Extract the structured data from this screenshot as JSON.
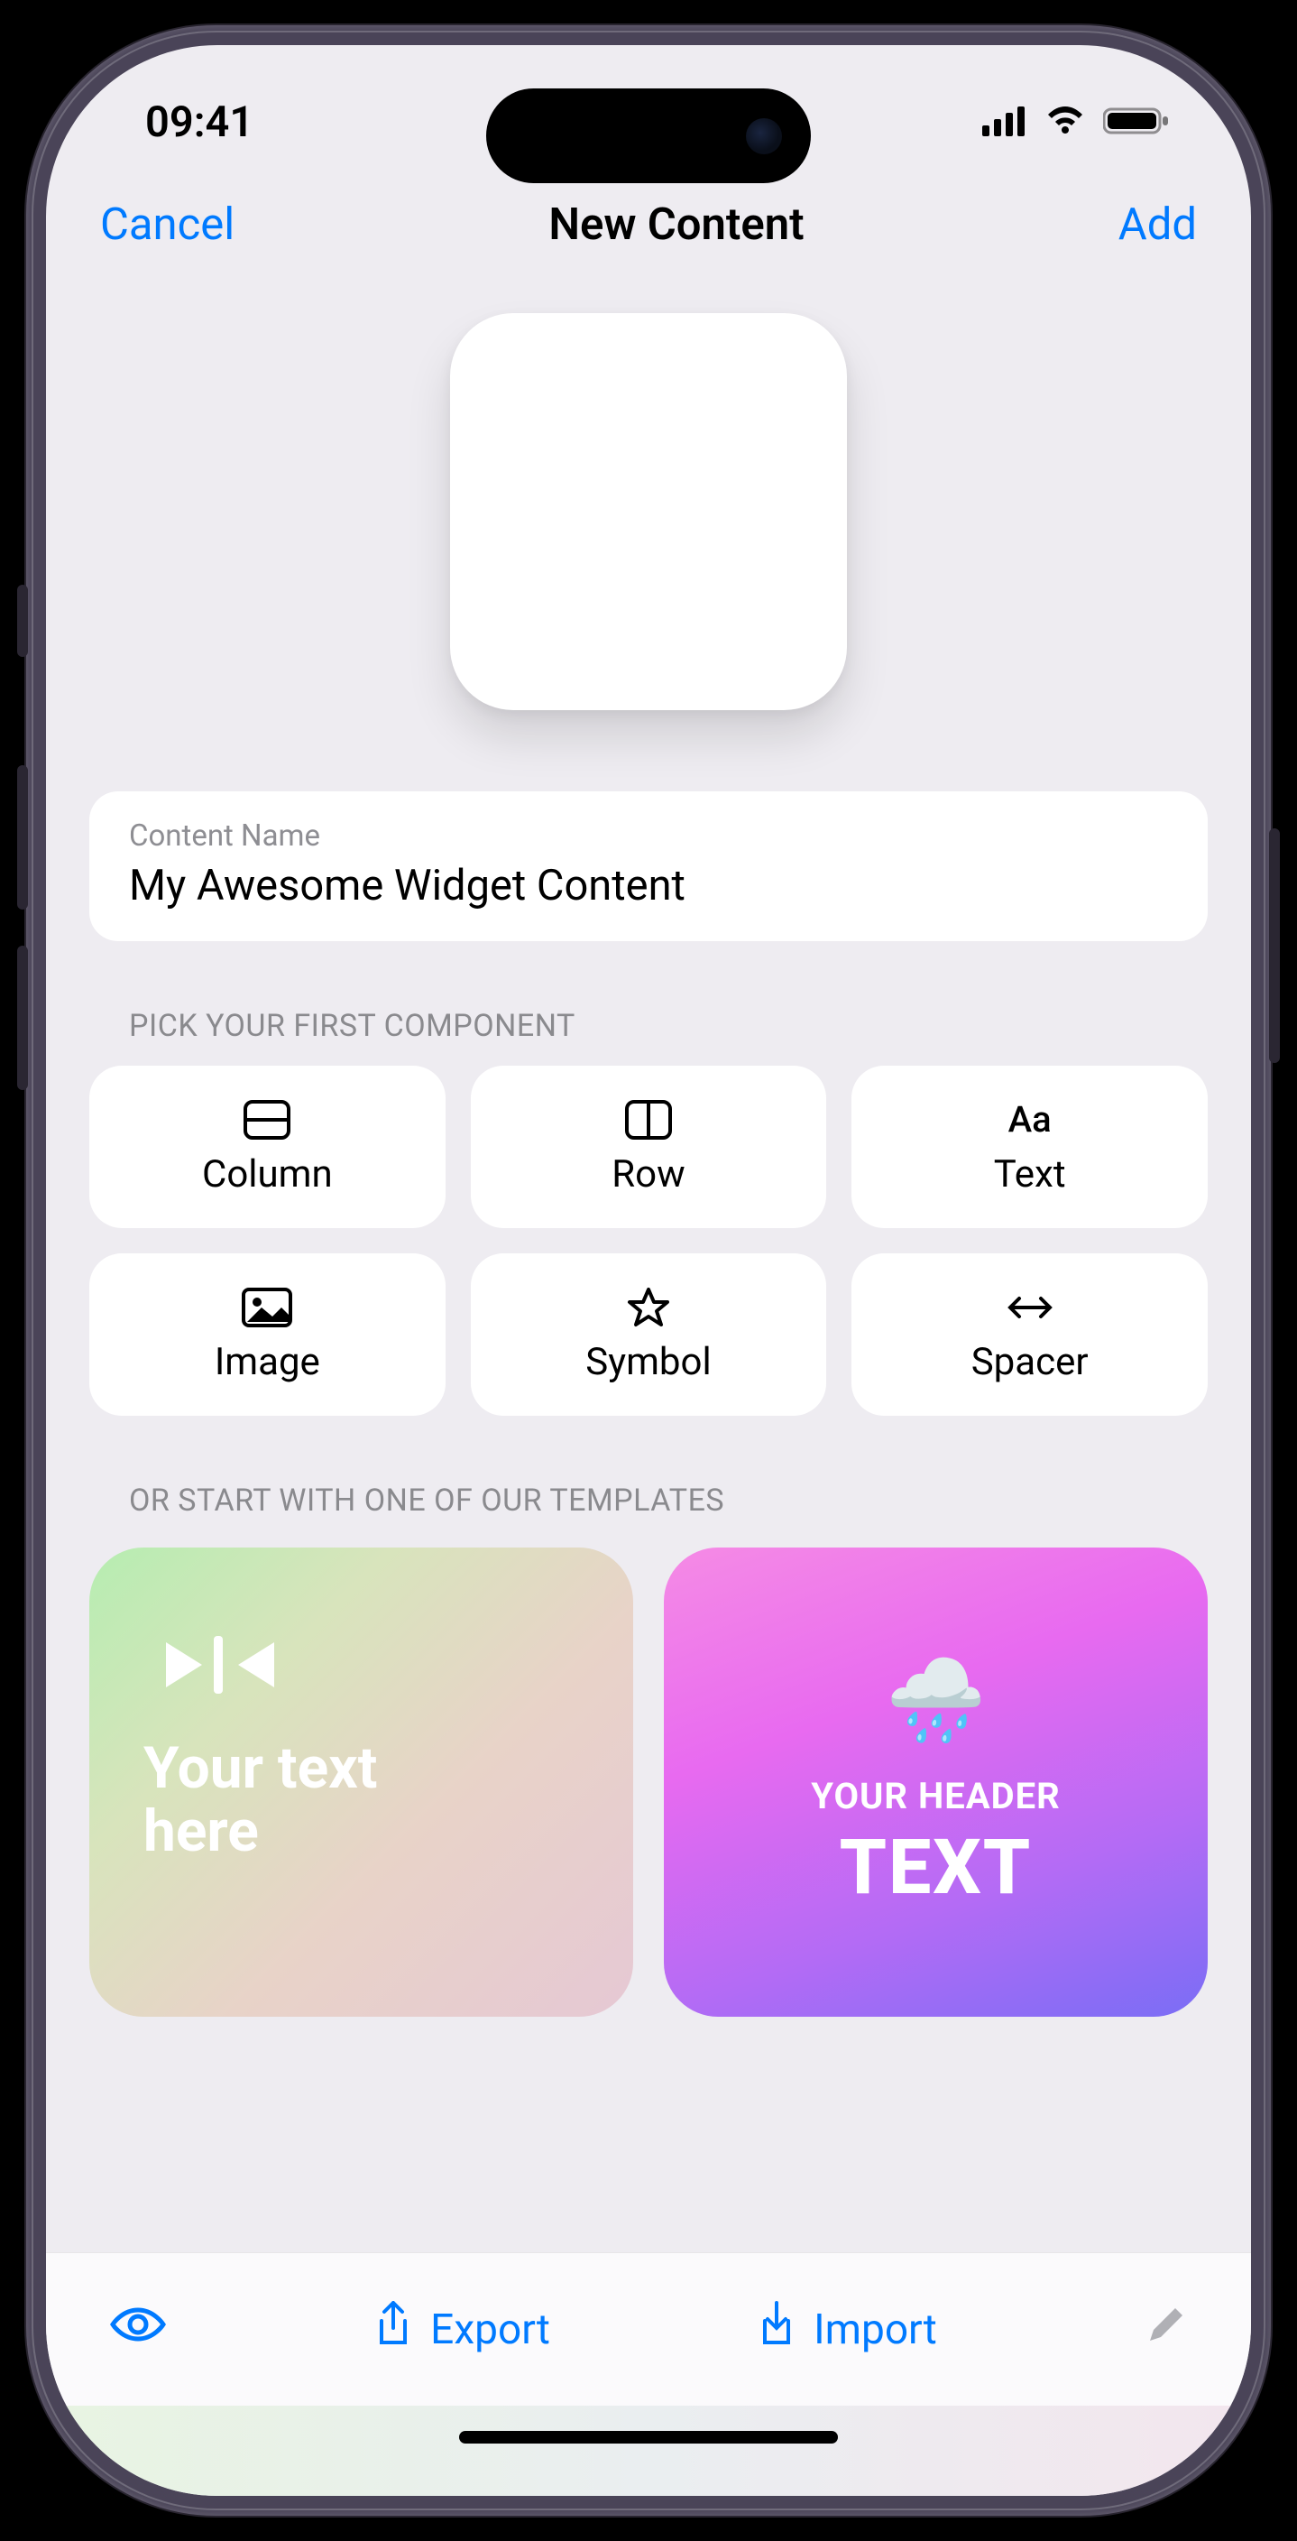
{
  "status": {
    "time": "09:41"
  },
  "nav": {
    "cancel": "Cancel",
    "title": "New Content",
    "add": "Add"
  },
  "nameField": {
    "label": "Content Name",
    "value": "My Awesome Widget Content"
  },
  "sections": {
    "components_header": "PICK YOUR FIRST COMPONENT",
    "templates_header": "OR START WITH ONE OF OUR TEMPLATES"
  },
  "components": [
    {
      "label": "Column",
      "icon": "column"
    },
    {
      "label": "Row",
      "icon": "row"
    },
    {
      "label": "Text",
      "icon": "text"
    },
    {
      "label": "Image",
      "icon": "image"
    },
    {
      "label": "Symbol",
      "icon": "symbol"
    },
    {
      "label": "Spacer",
      "icon": "spacer"
    }
  ],
  "templates": {
    "a": {
      "line1": "Your text",
      "line2": "here"
    },
    "b": {
      "emoji": "🌧️",
      "header": "YOUR HEADER",
      "big": "TEXT"
    }
  },
  "toolbar": {
    "export": "Export",
    "import": "Import"
  }
}
